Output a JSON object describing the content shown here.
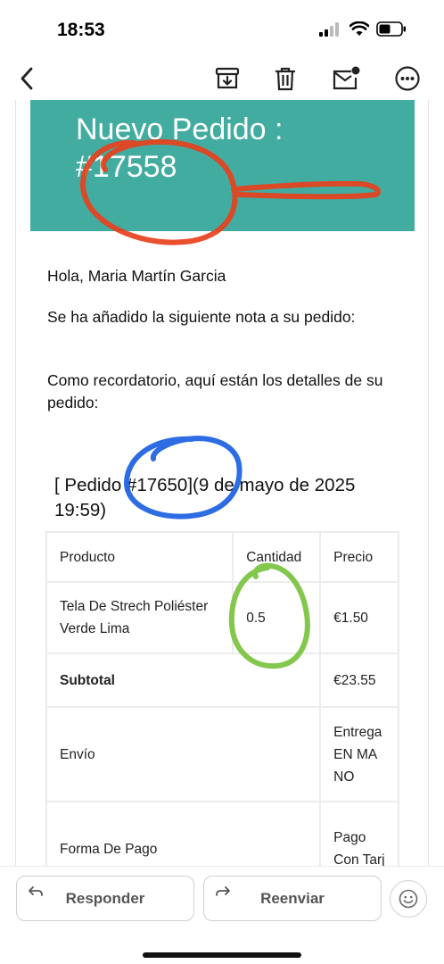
{
  "status_bar": {
    "time": "18:53"
  },
  "toolbar": {
    "back": "back-arrow",
    "actions": [
      "archive-icon",
      "trash-icon",
      "mark-unread-icon",
      "more-icon"
    ]
  },
  "email": {
    "banner": {
      "title_line1": "Nuevo Pedido :",
      "title_line2": "#17558",
      "color": "#42aca1"
    },
    "greeting": "Hola, Maria Martín Garcia",
    "note_intro": "Se ha añadido la siguiente nota a su pedido:",
    "reminder": "Como recordatorio, aquí están los detalles de su pedido:",
    "order_heading": "[ Pedido #17650](9 de mayo de 2025 19:59)",
    "table": {
      "headers": {
        "product": "Producto",
        "quantity": "Cantidad",
        "price": "Precio"
      },
      "item": {
        "product": "Tela De Strech Poliéster Verde Lima",
        "quantity": "0.5",
        "price": "€1.50"
      },
      "subtotal": {
        "label": "Subtotal",
        "value": "€23.55"
      },
      "shipping": {
        "label": "Envío",
        "value": "Entrega EN MANO"
      },
      "payment": {
        "label": "Forma De Pago",
        "value": "Pago Con Tarj"
      }
    }
  },
  "annotations": {
    "red": "#e8401c",
    "blue": "#1b5fe0",
    "green": "#7cc443"
  },
  "bottom_bar": {
    "reply": "Responder",
    "forward": "Reenviar"
  }
}
